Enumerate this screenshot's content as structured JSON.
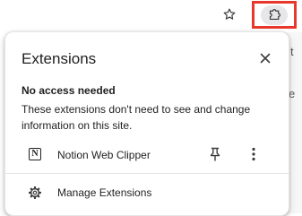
{
  "popup": {
    "title": "Extensions",
    "section_title": "No access needed",
    "section_desc": "These extensions don't need to see and change information on this site.",
    "extensions": [
      {
        "name": "Notion Web Clipper",
        "icon": "notion-icon",
        "icon_glyph": "N"
      }
    ],
    "manage_label": "Manage Extensions"
  },
  "background": {
    "glyph_1": "t",
    "glyph_2": "e"
  },
  "icons": {
    "bookmark": "star-icon",
    "extensions": "puzzle-icon",
    "close": "close-icon",
    "pin": "pin-icon",
    "more": "more-vertical-icon",
    "manage": "gear-icon"
  },
  "colors": {
    "highlight_border": "#e8382b",
    "text": "#1f1f1f",
    "button_highlight": "#e7e7e9"
  }
}
